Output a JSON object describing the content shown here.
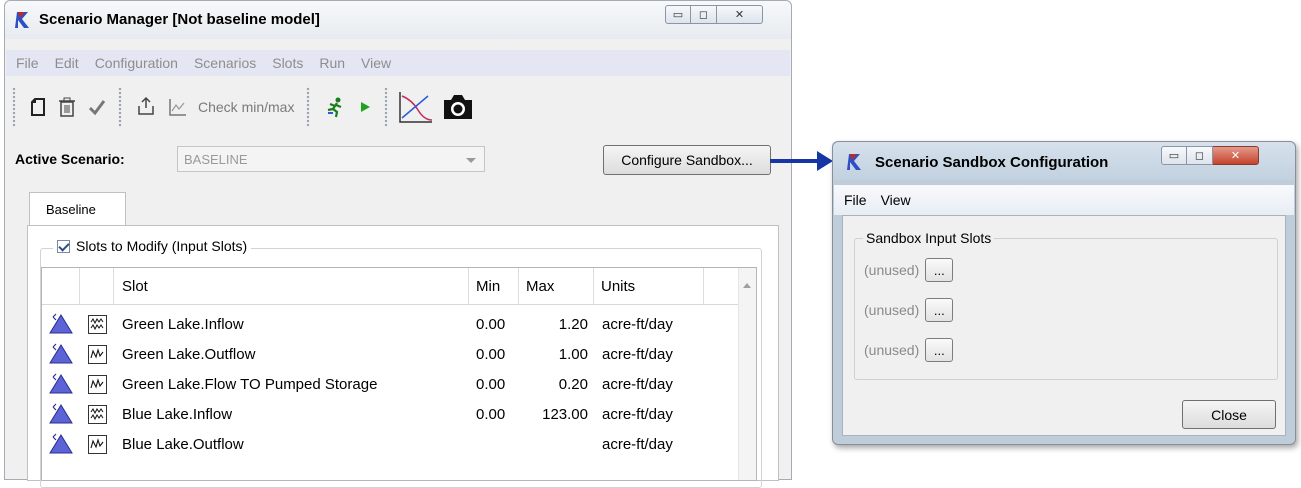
{
  "main_window": {
    "title": "Scenario Manager [Not baseline model]",
    "menu": [
      "File",
      "Edit",
      "Configuration",
      "Scenarios",
      "Slots",
      "Run",
      "View"
    ],
    "toolbar": {
      "new_icon": "new-document-icon",
      "delete_icon": "trash-icon",
      "check_icon": "checkmark-icon",
      "export_icon": "export-icon",
      "plot_icon": "plot-icon",
      "check_minmax_label": "Check min/max",
      "runner_icon": "runner-icon",
      "play_icon": "play-icon",
      "chart_icon": "chart-icon",
      "camera_icon": "camera-icon"
    },
    "active_scenario_label": "Active Scenario:",
    "active_scenario_value": "BASELINE",
    "configure_sandbox_label": "Configure Sandbox...",
    "tab_label": "Baseline",
    "group_label": "Slots to Modify (Input Slots)",
    "table": {
      "columns": [
        "Slot",
        "Min",
        "Max",
        "Units"
      ],
      "rows": [
        {
          "slot": "Green Lake.Inflow",
          "min": "0.00",
          "max": "1.20",
          "units": "acre-ft/day",
          "series_icon": "multi-series-icon"
        },
        {
          "slot": "Green Lake.Outflow",
          "min": "0.00",
          "max": "1.00",
          "units": "acre-ft/day",
          "series_icon": "series-icon"
        },
        {
          "slot": "Green Lake.Flow TO Pumped Storage",
          "min": "0.00",
          "max": "0.20",
          "units": "acre-ft/day",
          "series_icon": "series-icon"
        },
        {
          "slot": "Blue Lake.Inflow",
          "min": "0.00",
          "max": "123.00",
          "units": "acre-ft/day",
          "series_icon": "multi-series-icon"
        },
        {
          "slot": "Blue Lake.Outflow",
          "min": "",
          "max": "",
          "units": "acre-ft/day",
          "series_icon": "series-icon"
        }
      ]
    }
  },
  "sandbox_window": {
    "title": "Scenario Sandbox Configuration",
    "menu": [
      "File",
      "View"
    ],
    "group_label": "Sandbox Input Slots",
    "slots": [
      {
        "label": "(unused)",
        "button": "..."
      },
      {
        "label": "(unused)",
        "button": "..."
      },
      {
        "label": "(unused)",
        "button": "..."
      }
    ],
    "close_label": "Close"
  },
  "colors": {
    "arrow": "#1636a6",
    "triangle": "#5b63d6",
    "disabled_text": "#8d8d8d"
  }
}
